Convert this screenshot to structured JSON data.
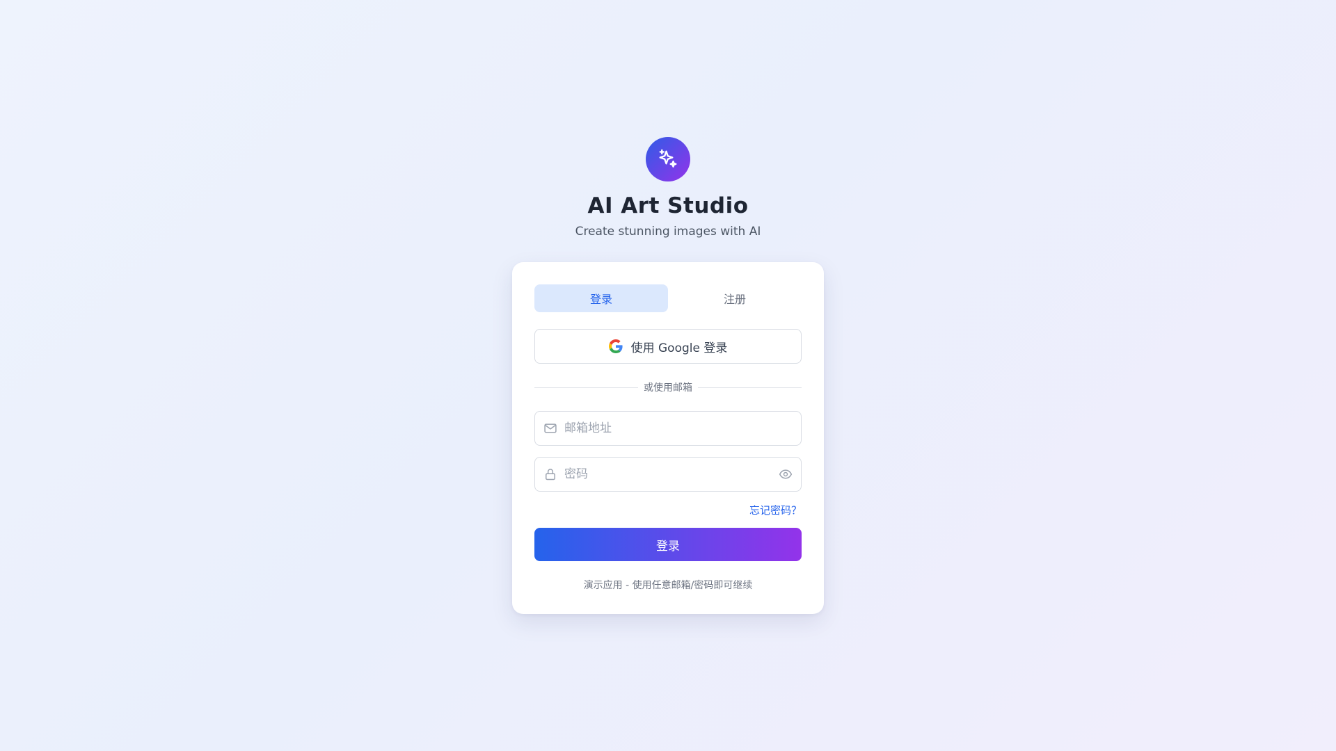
{
  "app": {
    "title": "AI Art Studio",
    "subtitle": "Create stunning images with AI",
    "logo_icon": "sparkles-icon"
  },
  "colors": {
    "accent": "#2563eb",
    "accent_end": "#9333ea",
    "tab_active_bg": "#dbe8fd"
  },
  "auth": {
    "tabs": [
      {
        "label": "登录",
        "active": true
      },
      {
        "label": "注册",
        "active": false
      }
    ],
    "google_button": {
      "label": "使用 Google 登录",
      "icon": "google-icon"
    },
    "divider_text": "或使用邮箱",
    "email": {
      "placeholder": "邮箱地址",
      "value": "",
      "icon": "mail-icon"
    },
    "password": {
      "placeholder": "密码",
      "value": "",
      "icon": "lock-icon",
      "toggle_icon": "eye-icon"
    },
    "forgot_label": "忘记密码？",
    "submit_label": "登录",
    "demo_note": "演示应用 - 使用任意邮箱/密码即可继续"
  }
}
